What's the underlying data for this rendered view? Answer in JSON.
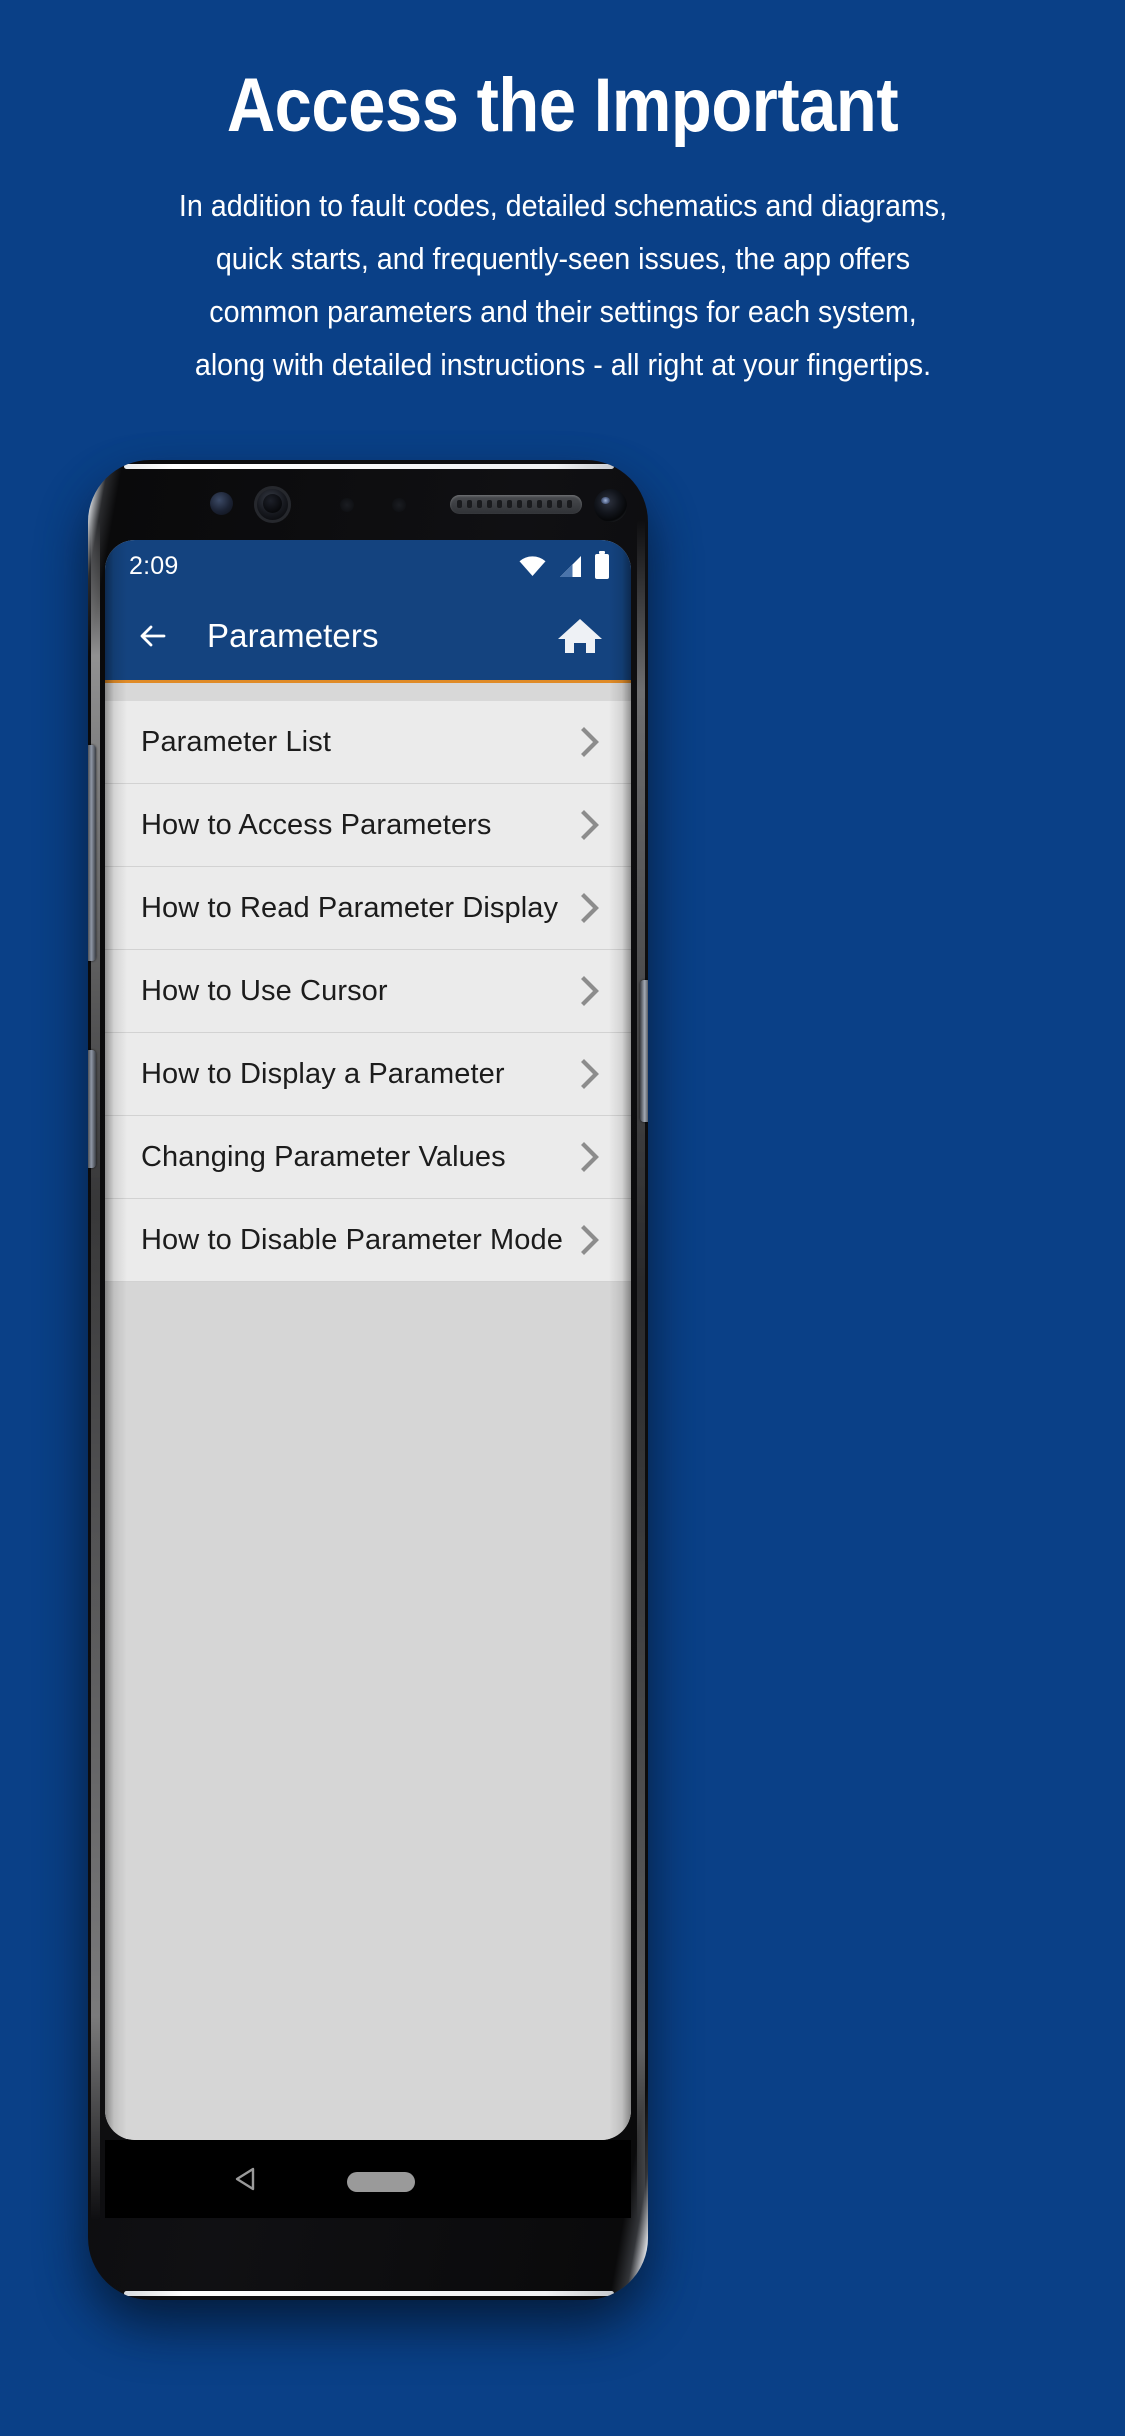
{
  "promo": {
    "title": "Access the Important",
    "body_lines": [
      "In addition to fault codes, detailed schematics and diagrams,",
      "quick starts, and frequently-seen issues, the app offers",
      "common parameters and their settings for each system,",
      "along with detailed instructions - all right at your fingertips."
    ]
  },
  "colors": {
    "background_blue": "#0a4087",
    "appbar_blue": "#14437f",
    "accent_orange": "#e08b27",
    "list_item_bg": "#ebebeb",
    "list_area_bg": "#d6d6d6",
    "text_dark": "#1c1c1c",
    "text_light": "#ffffff"
  },
  "phone": {
    "hardware": {
      "iris_scanner": "iris-scanner-icon",
      "ir_sensor": "ir-sensor-icon",
      "proximity_sensor_a": "proximity-sensor-icon",
      "proximity_sensor_b": "proximity-sensor-icon",
      "earpiece": "earpiece-speaker-icon",
      "front_camera": "front-camera-icon",
      "volume_button": "volume-button",
      "bixby_button": "bixby-button",
      "power_button": "power-button"
    },
    "navbar": {
      "back": "android-back-icon",
      "home": "android-home-pill"
    }
  },
  "statusbar": {
    "clock": "2:09",
    "icons": [
      "wifi-icon",
      "cellular-signal-icon",
      "battery-icon"
    ]
  },
  "appbar": {
    "back_icon": "arrow-left-icon",
    "title": "Parameters",
    "home_icon": "home-icon"
  },
  "list": {
    "chevron_icon": "chevron-right-icon",
    "items": [
      {
        "label": "Parameter List"
      },
      {
        "label": "How to Access Parameters"
      },
      {
        "label": "How to Read Parameter Display"
      },
      {
        "label": "How to Use Cursor"
      },
      {
        "label": "How to Display a Parameter"
      },
      {
        "label": "Changing Parameter Values"
      },
      {
        "label": "How to Disable Parameter Mode"
      }
    ]
  }
}
